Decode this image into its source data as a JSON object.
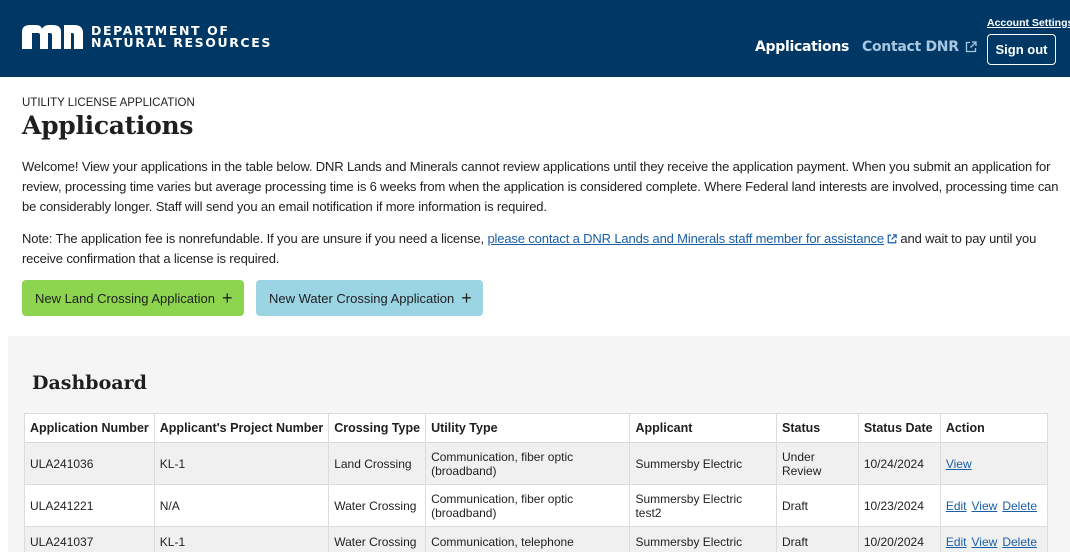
{
  "header": {
    "logo_line1": "DEPARTMENT OF",
    "logo_line2": "NATURAL RESOURCES",
    "nav": {
      "applications": "Applications",
      "contact": "Contact DNR"
    },
    "account_settings": "Account Settings",
    "sign_out": "Sign out",
    "colors": {
      "background": "#003865",
      "contact_link": "#a8c7e0"
    }
  },
  "intro": {
    "eyebrow": "UTILITY LICENSE APPLICATION",
    "title": "Applications",
    "paragraph1": "Welcome! View your applications in the table below. DNR Lands and Minerals cannot review applications until they receive the application payment. When you submit an application for review, processing time varies but average processing time is 6 weeks from when the application is considered complete. Where Federal land interests are involved, processing time can be considerably longer. Staff will send you an email notification if more information is required.",
    "note_prefix": "Note: The application fee is nonrefundable. If you are unsure if you need a license, ",
    "note_link": "please contact a DNR Lands and Minerals staff member for assistance",
    "note_suffix": " and wait to pay until you receive confirmation that a license is required."
  },
  "buttons": {
    "land": "New Land Crossing Application",
    "water": "New Water Crossing Application",
    "plus": "+",
    "colors": {
      "land": "#8dd44f",
      "water": "#9bd4e3"
    }
  },
  "dashboard": {
    "title": "Dashboard",
    "columns": [
      "Application Number",
      "Applicant's Project Number",
      "Crossing Type",
      "Utility Type",
      "Applicant",
      "Status",
      "Status Date",
      "Action"
    ],
    "rows": [
      {
        "app_no": "ULA241036",
        "project_no": "KL-1",
        "crossing": "Land Crossing",
        "utility": "Communication, fiber optic (broadband)",
        "applicant": "Summersby Electric",
        "status": "Under Review",
        "date": "10/24/2024",
        "actions": [
          "View"
        ]
      },
      {
        "app_no": "ULA241221",
        "project_no": "N/A",
        "crossing": "Water Crossing",
        "utility": "Communication, fiber optic (broadband)",
        "applicant": "Summersby Electric test2",
        "status": "Draft",
        "date": "10/23/2024",
        "actions": [
          "Edit",
          "View",
          "Delete"
        ]
      },
      {
        "app_no": "ULA241037",
        "project_no": "KL-1",
        "crossing": "Water Crossing",
        "utility": "Communication, telephone",
        "applicant": "Summersby Electric",
        "status": "Draft",
        "date": "10/20/2024",
        "actions": [
          "Edit",
          "View",
          "Delete"
        ]
      }
    ],
    "link_color": "#1a5ea8"
  }
}
